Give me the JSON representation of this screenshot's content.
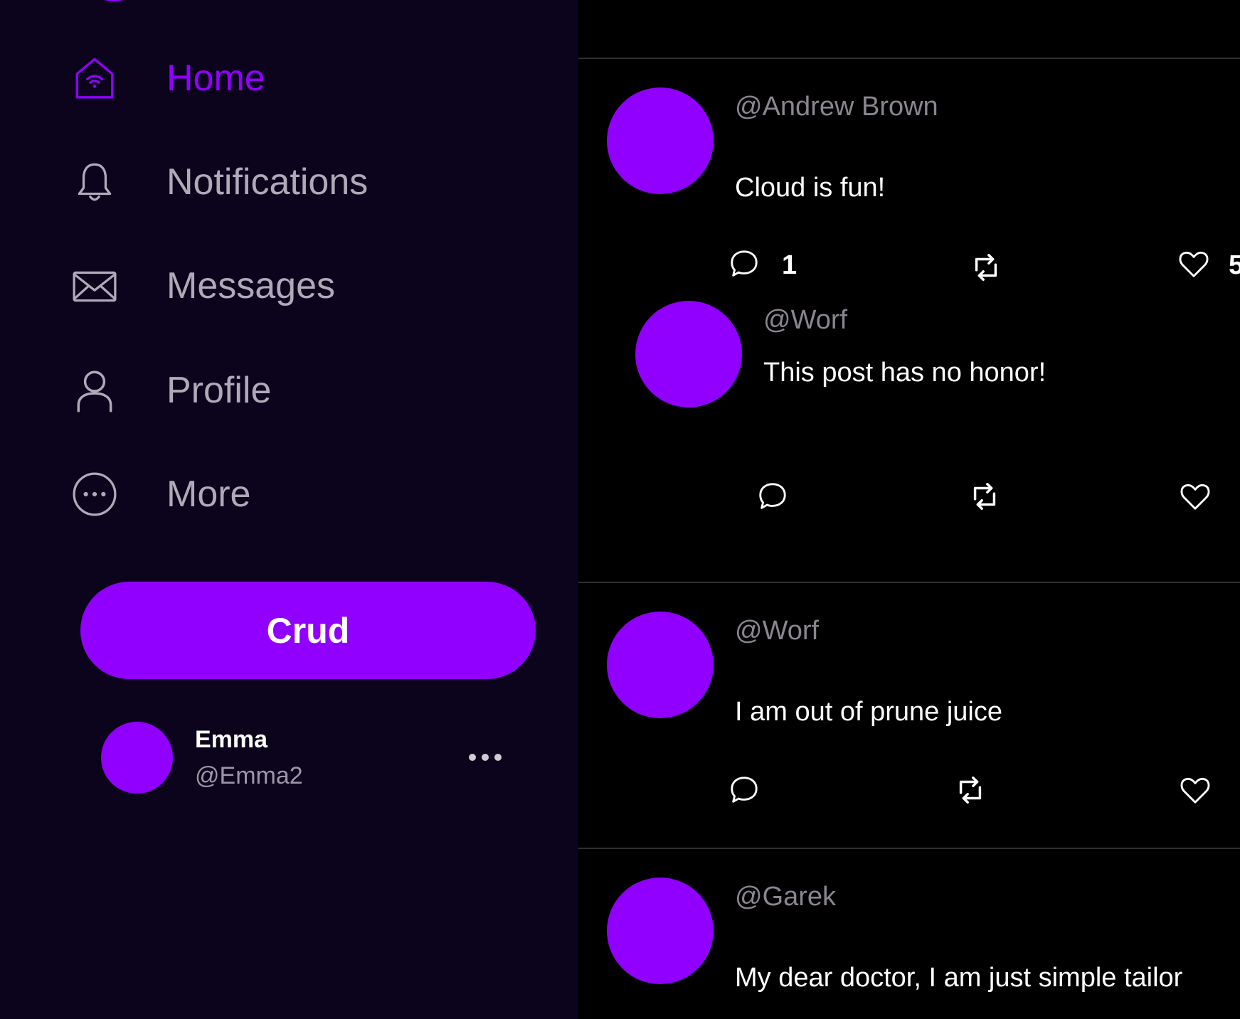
{
  "colors": {
    "accent": "#9100ff",
    "sidebar_bg": "#0b041c",
    "feed_bg": "#000000",
    "muted_text": "#b0a9b8"
  },
  "sidebar": {
    "nav": [
      {
        "label": "Home",
        "icon": "home-icon",
        "active": true
      },
      {
        "label": "Notifications",
        "icon": "bell-icon",
        "active": false
      },
      {
        "label": "Messages",
        "icon": "envelope-icon",
        "active": false
      },
      {
        "label": "Profile",
        "icon": "user-icon",
        "active": false
      },
      {
        "label": "More",
        "icon": "more-circle-icon",
        "active": false
      }
    ],
    "post_button_label": "Crud",
    "account": {
      "name": "Emma",
      "handle": "@Emma2"
    }
  },
  "feed": {
    "posts": [
      {
        "handle": "@Andrew Brown",
        "text": "Cloud is fun!",
        "reply_count": "1",
        "like_count": "5",
        "replies": [
          {
            "handle": "@Worf",
            "text": "This post has no honor!"
          }
        ]
      },
      {
        "handle": "@Worf",
        "text": "I am out of prune juice"
      },
      {
        "handle": "@Garek",
        "text": "My dear doctor, I am just simple tailor"
      }
    ]
  }
}
